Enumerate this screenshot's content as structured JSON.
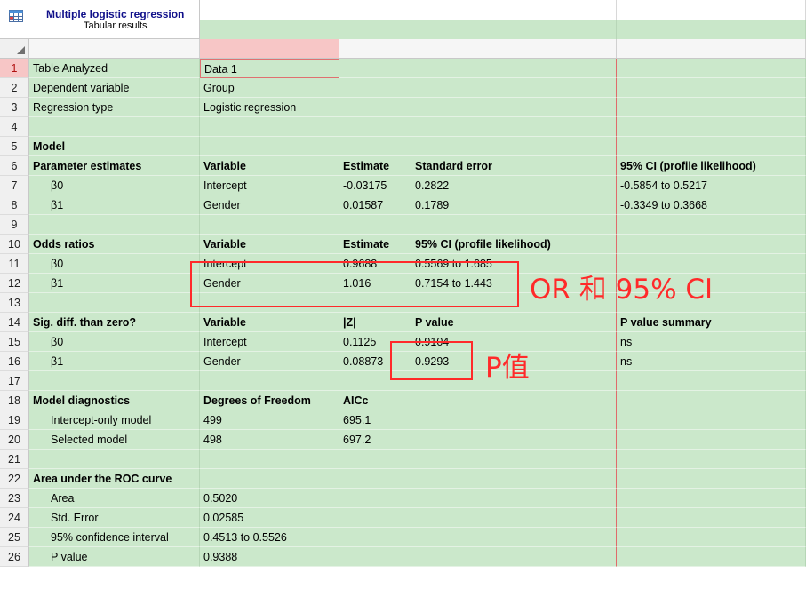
{
  "header": {
    "title": "Multiple logistic regression",
    "subtitle": "Tabular results",
    "icon": "table-results-icon"
  },
  "rows": [
    {
      "n": "1",
      "c": [
        "Table Analyzed",
        "Data 1",
        "",
        "",
        ""
      ]
    },
    {
      "n": "2",
      "c": [
        "Dependent variable",
        "Group",
        "",
        "",
        ""
      ]
    },
    {
      "n": "3",
      "c": [
        "Regression type",
        "Logistic regression",
        "",
        "",
        ""
      ]
    },
    {
      "n": "4",
      "c": [
        "",
        "",
        "",
        "",
        ""
      ]
    },
    {
      "n": "5",
      "c": [
        "Model",
        "",
        "",
        "",
        ""
      ],
      "bold": true
    },
    {
      "n": "6",
      "c": [
        "Parameter estimates",
        "Variable",
        "Estimate",
        "Standard error",
        "95% CI (profile likelihood)"
      ],
      "bold": true
    },
    {
      "n": "7",
      "c": [
        "β0",
        "Intercept",
        "-0.03175",
        "0.2822",
        "-0.5854 to 0.5217"
      ],
      "indent": true
    },
    {
      "n": "8",
      "c": [
        "β1",
        "Gender",
        "0.01587",
        "0.1789",
        "-0.3349 to 0.3668"
      ],
      "indent": true
    },
    {
      "n": "9",
      "c": [
        "",
        "",
        "",
        "",
        ""
      ]
    },
    {
      "n": "10",
      "c": [
        "Odds ratios",
        "Variable",
        "Estimate",
        "95% CI (profile likelihood)",
        ""
      ],
      "bold": true
    },
    {
      "n": "11",
      "c": [
        "β0",
        "Intercept",
        "0.9688",
        "0.5569 to 1.685",
        ""
      ],
      "indent": true
    },
    {
      "n": "12",
      "c": [
        "β1",
        "Gender",
        "1.016",
        "0.7154 to 1.443",
        ""
      ],
      "indent": true
    },
    {
      "n": "13",
      "c": [
        "",
        "",
        "",
        "",
        ""
      ]
    },
    {
      "n": "14",
      "c": [
        "Sig. diff. than zero?",
        "Variable",
        "|Z|",
        "P value",
        "P value summary"
      ],
      "bold": true
    },
    {
      "n": "15",
      "c": [
        "β0",
        "Intercept",
        "0.1125",
        "0.9104",
        "ns"
      ],
      "indent": true
    },
    {
      "n": "16",
      "c": [
        "β1",
        "Gender",
        "0.08873",
        "0.9293",
        "ns"
      ],
      "indent": true
    },
    {
      "n": "17",
      "c": [
        "",
        "",
        "",
        "",
        ""
      ]
    },
    {
      "n": "18",
      "c": [
        "Model diagnostics",
        "Degrees of Freedom",
        "AICc",
        "",
        ""
      ],
      "bold": true
    },
    {
      "n": "19",
      "c": [
        "Intercept-only model",
        "499",
        "695.1",
        "",
        ""
      ],
      "indent": true
    },
    {
      "n": "20",
      "c": [
        "Selected model",
        "498",
        "697.2",
        "",
        ""
      ],
      "indent": true
    },
    {
      "n": "21",
      "c": [
        "",
        "",
        "",
        "",
        ""
      ]
    },
    {
      "n": "22",
      "c": [
        "Area under the ROC curve",
        "",
        "",
        "",
        ""
      ],
      "bold": true
    },
    {
      "n": "23",
      "c": [
        "Area",
        "0.5020",
        "",
        "",
        ""
      ],
      "indent": true
    },
    {
      "n": "24",
      "c": [
        "Std. Error",
        "0.02585",
        "",
        "",
        ""
      ],
      "indent": true
    },
    {
      "n": "25",
      "c": [
        "95% confidence interval",
        "0.4513 to 0.5526",
        "",
        "",
        ""
      ],
      "indent": true
    },
    {
      "n": "26",
      "c": [
        "P value",
        "0.9388",
        "",
        "",
        ""
      ],
      "indent": true
    }
  ],
  "annotations": {
    "or_label": "OR 和 95% CI",
    "p_label": "P值",
    "color": "#ff2a2a"
  },
  "colors": {
    "cell_green": "#cbe8cb",
    "selection_pink": "#f7c6c6",
    "title_blue": "#10108a"
  }
}
